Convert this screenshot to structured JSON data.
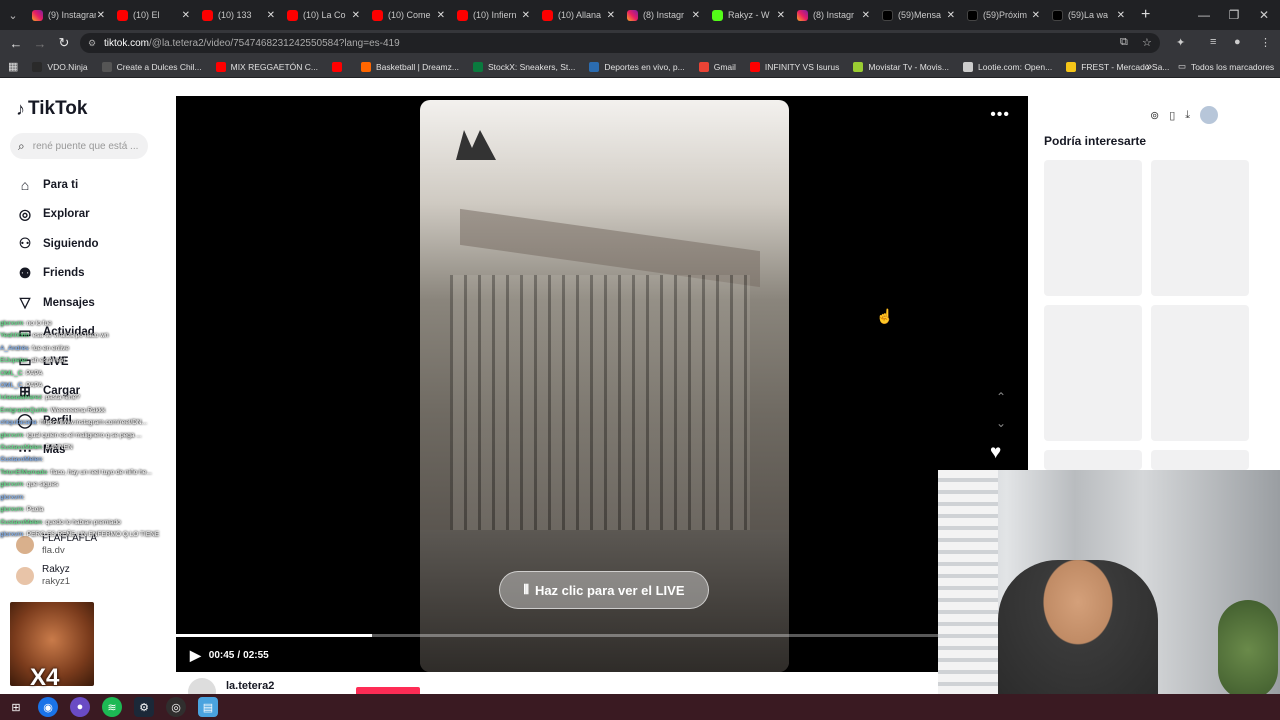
{
  "browser": {
    "tabs": [
      {
        "icon": "instagram",
        "title": "(9) Instagram"
      },
      {
        "icon": "youtube",
        "title": "(10) El"
      },
      {
        "icon": "youtube",
        "title": "(10) 133"
      },
      {
        "icon": "youtube",
        "title": "(10) La Co"
      },
      {
        "icon": "youtube",
        "title": "(10) Come"
      },
      {
        "icon": "youtube",
        "title": "(10) Infiern"
      },
      {
        "icon": "youtube",
        "title": "(10) Allana"
      },
      {
        "icon": "instagram",
        "title": "(8) Instagr"
      },
      {
        "icon": "kick",
        "title": "Rakyz - W"
      },
      {
        "icon": "instagram",
        "title": "(8) Instagr"
      },
      {
        "icon": "tiktok",
        "title": "(59)Mensa"
      },
      {
        "icon": "tiktok",
        "title": "(59)Próxim"
      },
      {
        "icon": "tiktok",
        "title": "(59)La wa"
      }
    ],
    "url_domain": "tiktok.com",
    "url_path": "/@la.tetera2/video/7547468231242550584?lang=es-419",
    "bookmarks": [
      {
        "label": "VDO.Ninja",
        "color": "#2a2a2a"
      },
      {
        "label": "Create a Dulces Chil...",
        "color": "#555"
      },
      {
        "label": "MIX REGGAETÓN C...",
        "color": "#ff0000"
      },
      {
        "label": "",
        "color": "#ff0000"
      },
      {
        "label": "Basketball | Dreamz...",
        "color": "#ff6600"
      },
      {
        "label": "StockX: Sneakers, St...",
        "color": "#0a7a3e"
      },
      {
        "label": "Deportes en vivo, p...",
        "color": "#2b6cb0"
      },
      {
        "label": "Gmail",
        "color": "#ea4335"
      },
      {
        "label": "INFINITY VS Isurus",
        "color": "#ff0000"
      },
      {
        "label": "Movistar Tv - Movis...",
        "color": "#9acd32"
      },
      {
        "label": "Lootie.com: Open...",
        "color": "#cccccc"
      },
      {
        "label": "FREST - Mercado Sa...",
        "color": "#f5c518"
      }
    ],
    "all_bookmarks": "Todos los marcadores"
  },
  "tiktok": {
    "logo": "TikTok",
    "search_placeholder": "rené puente que está ...",
    "nav": [
      {
        "label": "Para ti",
        "icon": "home-icon"
      },
      {
        "label": "Explorar",
        "icon": "compass-icon"
      },
      {
        "label": "Siguiendo",
        "icon": "following-icon"
      },
      {
        "label": "Friends",
        "icon": "friends-icon"
      },
      {
        "label": "Mensajes",
        "icon": "messages-icon"
      },
      {
        "label": "Actividad",
        "icon": "activity-icon"
      },
      {
        "label": "LIVE",
        "icon": "live-icon"
      },
      {
        "label": "Cargar",
        "icon": "upload-icon"
      },
      {
        "label": "Perfil",
        "icon": "profile-icon"
      },
      {
        "label": "Más",
        "icon": "more-icon"
      }
    ],
    "following_accounts": [
      {
        "name": "FLAFLAFLA",
        "handle": "fla.dv"
      },
      {
        "name": "Rakyz",
        "handle": "rakyz1"
      }
    ],
    "video": {
      "live_prompt": "Haz clic para ver el LIVE",
      "time_current": "00:45",
      "time_total": "02:55",
      "progress": 0.257,
      "author": "la.tetera2"
    },
    "recommend_title": "Podría interesarte"
  },
  "chat_overlay": [
    {
      "user": "glorxvrn",
      "msg": "no lo fue"
    },
    {
      "user": "Yeahhhhh",
      "msg": "esa se viraliza po flaco wn"
    },
    {
      "user": "A_Andrés",
      "msg": "fue en enlive"
    },
    {
      "user": "ElJupeter",
      "msg": "ah está real"
    },
    {
      "user": "OML_C",
      "msg": "PAPA"
    },
    {
      "user": "OML_C",
      "msg": "PAPA"
    },
    {
      "user": "lolaaaaalvarez",
      "msg": "pasta rené?"
    },
    {
      "user": "EmigranteQuirlo",
      "msg": "Weeeeeena Rakkk"
    },
    {
      "user": "chiquitacana",
      "msg": "https://www.instagram.com/reel/DN..."
    },
    {
      "user": "glorxvrn",
      "msg": "igual quien es el malignero q se pega ..."
    },
    {
      "user": "GustavoMelen",
      "msg": "BANNEN"
    },
    {
      "user": "GustavoMelen",
      "msg": ""
    },
    {
      "user": "TetonElMamado",
      "msg": "flaco, hay un reel tuyo de niño he..."
    },
    {
      "user": "glorxvrn",
      "msg": "que sigues"
    },
    {
      "user": "glorxvrn",
      "msg": ""
    },
    {
      "user": "glorxvrn",
      "msg": "Paola"
    },
    {
      "user": "GustavoMelen",
      "msg": "quedo lo habian premiado"
    },
    {
      "user": "glorxvrn",
      "msg": "PERO ES REÑE UN ENFERMO Q LO TIENE"
    }
  ],
  "emote": {
    "label": "X4"
  }
}
